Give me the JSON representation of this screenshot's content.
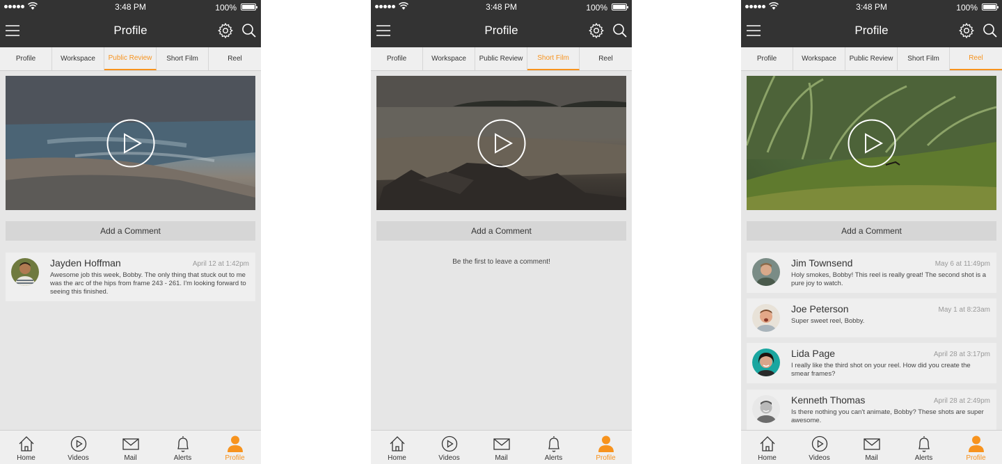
{
  "accent_color": "#f7931e",
  "screens": [
    {
      "status": {
        "time": "3:48 PM",
        "battery": "100%"
      },
      "nav": {
        "title": "Profile"
      },
      "tabs": [
        "Profile",
        "Workspace",
        "Public Review",
        "Short Film",
        "Reel"
      ],
      "active_tab": "Public Review",
      "video_scene": "stormy beach",
      "add_comment_label": "Add a Comment",
      "empty_message": "",
      "comments": [
        {
          "name": "Jayden Hoffman",
          "date": "April 12 at 1:42pm",
          "text": "Awesome job this week, Bobby. The only thing that stuck out to me was the arc of the hips from frame 243 - 261. I'm looking forward to seeing this finished."
        }
      ],
      "bottom_nav": [
        {
          "label": "Home",
          "icon": "home-icon"
        },
        {
          "label": "Videos",
          "icon": "play-circle-icon"
        },
        {
          "label": "Mail",
          "icon": "mail-icon"
        },
        {
          "label": "Alerts",
          "icon": "bell-icon"
        },
        {
          "label": "Profile",
          "icon": "person-icon"
        }
      ],
      "active_bottom": "Profile"
    },
    {
      "status": {
        "time": "3:48 PM",
        "battery": "100%"
      },
      "nav": {
        "title": "Profile"
      },
      "tabs": [
        "Profile",
        "Workspace",
        "Public Review",
        "Short Film",
        "Reel"
      ],
      "active_tab": "Short Film",
      "video_scene": "rocky beach with islands",
      "add_comment_label": "Add a Comment",
      "empty_message": "Be the first to leave a comment!",
      "comments": [],
      "bottom_nav": [
        {
          "label": "Home",
          "icon": "home-icon"
        },
        {
          "label": "Videos",
          "icon": "play-circle-icon"
        },
        {
          "label": "Mail",
          "icon": "mail-icon"
        },
        {
          "label": "Alerts",
          "icon": "bell-icon"
        },
        {
          "label": "Profile",
          "icon": "person-icon"
        }
      ],
      "active_bottom": "Profile"
    },
    {
      "status": {
        "time": "3:48 PM",
        "battery": "100%"
      },
      "nav": {
        "title": "Profile"
      },
      "tabs": [
        "Profile",
        "Workspace",
        "Public Review",
        "Short Film",
        "Reel"
      ],
      "active_tab": "Reel",
      "video_scene": "mossy grass with ant",
      "add_comment_label": "Add a Comment",
      "empty_message": "",
      "comments": [
        {
          "name": "Jim Townsend",
          "date": "May 6 at 11:49pm",
          "text": "Holy smokes, Bobby! This reel is really great! The second shot is a pure joy to watch."
        },
        {
          "name": "Joe Peterson",
          "date": "May 1 at 8:23am",
          "text": "Super sweet reel, Bobby."
        },
        {
          "name": "Lida Page",
          "date": "April 28 at 3:17pm",
          "text": "I really like the third shot on your reel. How did you create the smear frames?"
        },
        {
          "name": "Kenneth Thomas",
          "date": "April 28 at 2:49pm",
          "text": "Is there nothing you can't animate, Bobby? These shots are super awesome."
        }
      ],
      "bottom_nav": [
        {
          "label": "Home",
          "icon": "home-icon"
        },
        {
          "label": "Videos",
          "icon": "play-circle-icon"
        },
        {
          "label": "Mail",
          "icon": "mail-icon"
        },
        {
          "label": "Alerts",
          "icon": "bell-icon"
        },
        {
          "label": "Profile",
          "icon": "person-icon"
        }
      ],
      "active_bottom": "Profile"
    }
  ]
}
